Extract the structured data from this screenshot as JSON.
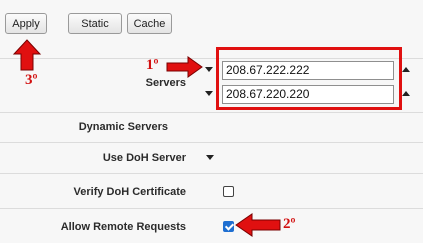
{
  "toolbar": {
    "apply_label": "Apply",
    "static_label": "Static",
    "cache_label": "Cache"
  },
  "servers": {
    "label": "Servers",
    "entries": [
      "208.67.222.222",
      "208.67.220.220"
    ]
  },
  "rows": {
    "dynamic_servers_label": "Dynamic Servers",
    "use_doh_label": "Use DoH Server",
    "verify_doh_label": "Verify DoH Certificate",
    "verify_doh_checked": false,
    "allow_remote_label": "Allow Remote Requests",
    "allow_remote_checked": true
  },
  "annotations": {
    "step1": "1º",
    "step2": "2º",
    "step3": "3º",
    "color": "#e01010"
  }
}
